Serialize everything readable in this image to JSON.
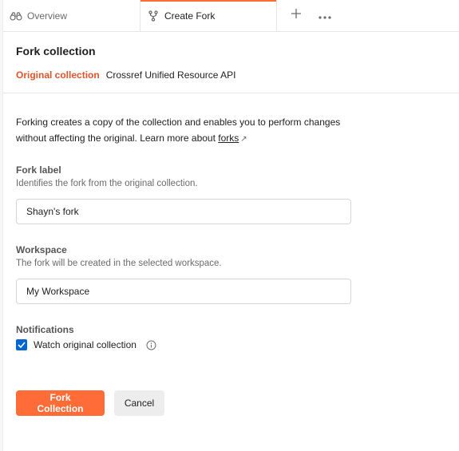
{
  "tabs": [
    {
      "label": "Overview",
      "icon": "binoculars-icon",
      "active": false
    },
    {
      "label": "Create Fork",
      "icon": "fork-icon",
      "active": true
    }
  ],
  "tab_actions": {
    "new_tab_icon": "plus-icon",
    "more_icon": "ellipsis-icon"
  },
  "page": {
    "title": "Fork collection",
    "original_label": "Original collection",
    "original_value": "Crossref Unified Resource API",
    "description": "Forking creates a copy of the collection and enables you to perform changes without affecting the original. Learn more about",
    "learn_more_link": "forks",
    "learn_more_icon": "↗"
  },
  "fork_label": {
    "label": "Fork label",
    "help": "Identifies the fork from the original collection.",
    "value": "Shayn's fork"
  },
  "workspace": {
    "label": "Workspace",
    "help": "The fork will be created in the selected workspace.",
    "value": "My Workspace"
  },
  "notifications": {
    "label": "Notifications",
    "checkbox_label": "Watch original collection",
    "checked": true,
    "info_icon": "info-icon"
  },
  "buttons": {
    "primary": "Fork Collection",
    "secondary": "Cancel"
  },
  "colors": {
    "accent": "#ff6c37",
    "original_label": "#e0542a",
    "checkbox": "#0265d2"
  }
}
